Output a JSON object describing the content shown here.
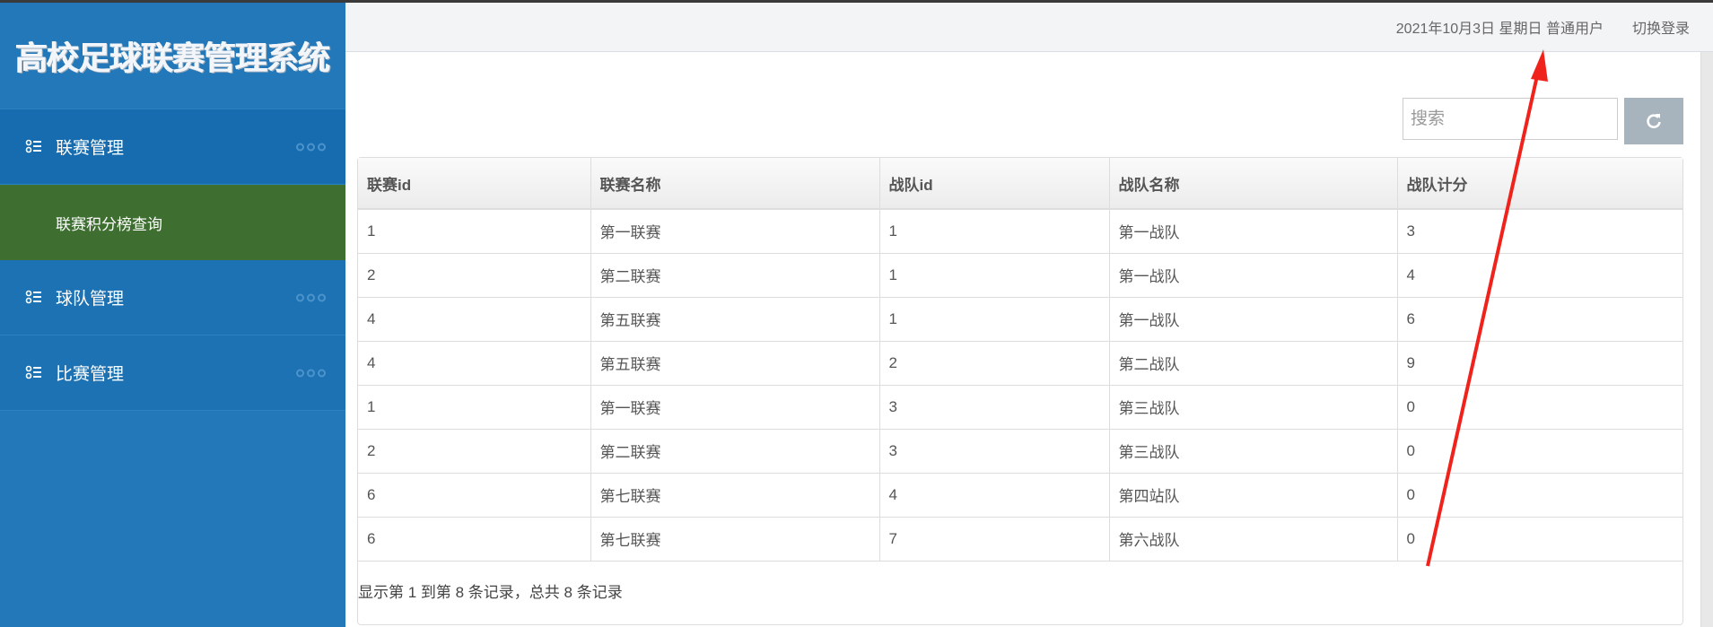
{
  "app_title": "高校足球联赛管理系统",
  "sidebar": {
    "items": [
      {
        "label": "联赛管理",
        "sub": [
          {
            "label": "联赛积分榜查询"
          }
        ]
      },
      {
        "label": "球队管理"
      },
      {
        "label": "比赛管理"
      }
    ]
  },
  "header": {
    "date": "2021年10月3日 星期日",
    "role": "普通用户",
    "switch_login": "切换登录"
  },
  "search": {
    "placeholder": "搜索"
  },
  "table": {
    "columns": [
      "联赛id",
      "联赛名称",
      "战队id",
      "战队名称",
      "战队计分"
    ],
    "rows": [
      [
        "1",
        "第一联赛",
        "1",
        "第一战队",
        "3"
      ],
      [
        "2",
        "第二联赛",
        "1",
        "第一战队",
        "4"
      ],
      [
        "4",
        "第五联赛",
        "1",
        "第一战队",
        "6"
      ],
      [
        "4",
        "第五联赛",
        "2",
        "第二战队",
        "9"
      ],
      [
        "1",
        "第一联赛",
        "3",
        "第三战队",
        "0"
      ],
      [
        "2",
        "第二联赛",
        "3",
        "第三战队",
        "0"
      ],
      [
        "6",
        "第七联赛",
        "4",
        "第四站队",
        "0"
      ],
      [
        "6",
        "第七联赛",
        "7",
        "第六战队",
        "0"
      ]
    ]
  },
  "pagination_info": "显示第 1 到第 8 条记录，总共 8 条记录",
  "colors": {
    "sidebar": "#2278b9",
    "active_sub": "#3e6f31",
    "annotation_arrow": "#f0231c"
  }
}
